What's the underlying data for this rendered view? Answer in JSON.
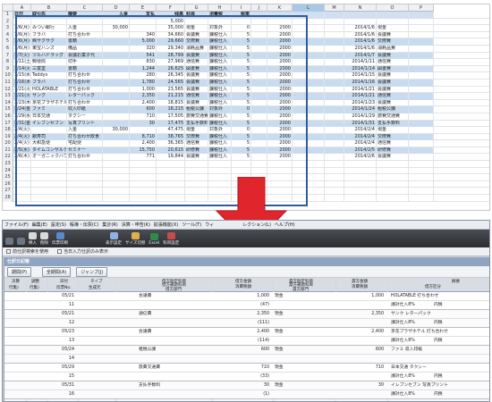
{
  "sheet": {
    "columns": [
      "",
      "A",
      "B",
      "C",
      "D",
      "E",
      "F",
      "G",
      "H",
      "I",
      "J",
      "K",
      "L",
      "M",
      "N",
      "O",
      "P"
    ],
    "selected_column": "L",
    "header_row": {
      "num": "1",
      "cells": [
        "日付",
        "取引先",
        "摘要",
        "入金",
        "支払",
        "残高",
        "科目",
        "消費税",
        "税率"
      ]
    },
    "rows": [
      {
        "num": "2",
        "cells": [
          "",
          "",
          "",
          "",
          "",
          "5,000",
          "",
          "",
          ""
        ]
      },
      {
        "num": "3",
        "cells": [
          "1/6(月)",
          "みつい銀行",
          "入金",
          "30,000",
          "",
          "35,000",
          "現金",
          "対象外",
          "0"
        ],
        "k": "2000",
        "n": "2014/1/6",
        "o": "現金",
        "hl": false
      },
      {
        "num": "4",
        "cells": [
          "1/6(月)",
          "フラバ",
          "打ち合わせ",
          "",
          "340",
          "34,660",
          "会議費",
          "課税仕入",
          "5"
        ],
        "k": "2000",
        "n": "2014/1/6",
        "o": "会議費",
        "hl": false
      },
      {
        "num": "5",
        "cells": [
          "1/6(月)",
          "㈱サクサク",
          "書籍",
          "",
          "5,000",
          "29,660",
          "交際費",
          "課税仕入",
          "5"
        ],
        "k": "2000",
        "n": "2014/1/6",
        "o": "交際費",
        "hl": true
      },
      {
        "num": "6",
        "cells": [
          "1/6(月)",
          "東宝ハンズ",
          "備品",
          "",
          "320",
          "29,340",
          "消耗品費",
          "課税仕入",
          "5"
        ],
        "k": "2000",
        "n": "2014/1/6",
        "o": "消耗品費",
        "hl": false
      },
      {
        "num": "7",
        "cells": [
          "1/7(火)",
          "ツルハドラッグ",
          "会議お菓子代",
          "",
          "541",
          "28,799",
          "会議費",
          "課税仕入",
          "5"
        ],
        "k": "2000",
        "n": "2014/1/7",
        "o": "会議費",
        "hl": true
      },
      {
        "num": "8",
        "cells": [
          "1/11(土)",
          "郵便局",
          "切手",
          "",
          "830",
          "27,969",
          "通信費",
          "課税仕入",
          "5"
        ],
        "k": "2000",
        "n": "2014/1/11",
        "o": "通信費",
        "hl": false
      },
      {
        "num": "9",
        "cells": [
          "1/14(火)",
          "三富堂",
          "書籍",
          "",
          "1,244",
          "26,625",
          "図書費",
          "課税仕入",
          "5"
        ],
        "k": "2000",
        "n": "2014/1/14",
        "o": "図書費",
        "hl": true
      },
      {
        "num": "10",
        "cells": [
          "1/15(水)",
          "Teddys",
          "打ち合わせ",
          "",
          "280",
          "26,345",
          "会議費",
          "課税仕入",
          "5"
        ],
        "k": "2000",
        "n": "2014/1/15",
        "o": "会議費",
        "hl": false
      },
      {
        "num": "11",
        "cells": [
          "1/16(木)",
          "フラバ",
          "打ち合わせ",
          "",
          "1,780",
          "24,565",
          "会議費",
          "課税仕入",
          "5"
        ],
        "k": "2000",
        "n": "2014/1/16",
        "o": "会議費",
        "hl": true
      },
      {
        "num": "12",
        "cells": [
          "1/21(火)",
          "HOLATABLE",
          "打ち合わせ",
          "",
          "1,000",
          "23,565",
          "会議費",
          "課税仕入",
          "5"
        ],
        "k": "2000",
        "n": "2014/1/21",
        "o": "会議費",
        "hl": false
      },
      {
        "num": "13",
        "cells": [
          "1/21(火)",
          "サンク",
          "レターパック",
          "",
          "2,350",
          "21,215",
          "通信費",
          "課税仕入",
          "5"
        ],
        "k": "2000",
        "n": "2014/1/21",
        "o": "通信費",
        "hl": true
      },
      {
        "num": "14",
        "cells": [
          "1/23(木)",
          "京花プラザホテル",
          "打ち合わせ",
          "",
          "2,400",
          "18,815",
          "会議費",
          "課税仕入",
          "5"
        ],
        "k": "2000",
        "n": "2014/1/23",
        "o": "会議費",
        "hl": false
      },
      {
        "num": "15",
        "cells": [
          "1/24(金)",
          "ファミ",
          "収入印紙",
          "",
          "600",
          "18,215",
          "租税公課",
          "対象外",
          "0"
        ],
        "k": "2000",
        "n": "2014/1/24",
        "o": "租税公課",
        "hl": true
      },
      {
        "num": "16",
        "cells": [
          "1/29(水)",
          "日本交通",
          "タクシー",
          "",
          "710",
          "17,505",
          "旅費交通費",
          "課税仕入",
          "5"
        ],
        "k": "2000",
        "n": "2014/1/29",
        "o": "旅費交通費",
        "hl": false
      },
      {
        "num": "17",
        "cells": [
          "1/31(金)",
          "イレブンセブン",
          "写真プリント",
          "",
          "30",
          "17,475",
          "支払手数料",
          "課税仕入",
          "5"
        ],
        "k": "2000",
        "n": "2014/1/31",
        "o": "支払手数料",
        "hl": true
      },
      {
        "num": "18",
        "cells": [
          "2/4(火)",
          "",
          "入金",
          "30,000",
          "",
          "47,475",
          "現金",
          "対象外",
          "0"
        ],
        "k": "2000",
        "n": "2014/2/4",
        "o": "現金",
        "hl": false
      },
      {
        "num": "19",
        "cells": [
          "2/4(火)",
          "銀寿司",
          "打ち合わせ飲食",
          "",
          "8,710",
          "38,765",
          "交際費",
          "課税仕入",
          "5"
        ],
        "k": "2000",
        "n": "2014/2/4",
        "o": "交際費",
        "hl": true
      },
      {
        "num": "20",
        "cells": [
          "2/4(火)",
          "大和急便",
          "宅配便",
          "",
          "2,400",
          "36,365",
          "通信費",
          "課税仕入",
          "5"
        ],
        "k": "2000",
        "n": "2014/2/4",
        "o": "通信費",
        "hl": false
      },
      {
        "num": "21",
        "cells": [
          "2/5(水)",
          "タイムコンサルティング",
          "セミナー",
          "",
          "15,750",
          "20,615",
          "研修費",
          "課税仕入",
          "5"
        ],
        "k": "2000",
        "n": "2014/2/5",
        "o": "研修費",
        "hl": true
      },
      {
        "num": "22",
        "cells": [
          "2/6(木)",
          "オーガニックハウス",
          "打ち合わせ",
          "",
          "771",
          "19,844",
          "会議費",
          "課税仕入",
          "5"
        ],
        "k": "2000",
        "n": "2014/2/6",
        "o": "会議費",
        "hl": false
      },
      {
        "num": "23",
        "cells": [
          "",
          "",
          "",
          "",
          "",
          "",
          "",
          "",
          ""
        ]
      },
      {
        "num": "24",
        "cells": [
          "",
          "",
          "",
          "",
          "",
          "",
          "",
          "",
          ""
        ]
      },
      {
        "num": "25",
        "cells": [
          "",
          "",
          "",
          "",
          "",
          "",
          "",
          "",
          ""
        ]
      },
      {
        "num": "26",
        "cells": [
          "",
          "",
          "",
          "",
          "",
          "",
          "",
          "",
          ""
        ]
      },
      {
        "num": "27",
        "cells": [
          "",
          "",
          "",
          "",
          "",
          "",
          "",
          "",
          ""
        ]
      },
      {
        "num": "28",
        "cells": [
          "",
          "",
          "",
          "",
          "",
          "",
          "",
          "",
          ""
        ]
      }
    ]
  },
  "app": {
    "menu": [
      "ファイル(F)",
      "編集(E)",
      "設定(S)",
      "帳簿・伝票(C)",
      "集計(R)",
      "決算・申告(K)",
      "拡張機能(X)",
      "ツール(T)",
      "ウィ",
      "",
      "レクション(L)",
      "ヘルプ(H)"
    ],
    "toolbar": [
      "",
      "",
      "挿入",
      "削除",
      "伝票印刷",
      "",
      "表示設定",
      "サイズ切替",
      "Excel",
      "科目設定"
    ],
    "options": [
      "前仕訳検索を使用",
      "当日入力仕訳のみ表示"
    ],
    "panel_title": "仕訳日記帳",
    "buttons": [
      "期間(P)",
      "全期間(A)",
      "ジャンプ(J)"
    ],
    "headers": {
      "kessai": "決算",
      "kessai2": "行集)",
      "choshu": "調整",
      "choshu2": "行集)",
      "date": "日付",
      "no": "伝票No.",
      "type": "タイプ",
      "type2": "生成元",
      "debit": "借方勘定科目",
      "debit2": "借方補助科目",
      "debit3": "借方部門",
      "damt": "借方金額",
      "dtax": "消費税額",
      "credit": "貸方勘定科目",
      "credit2": "貸方補助科目",
      "credit3": "貸方部門",
      "camt": "貸方金額",
      "ctax": "消費税額",
      "desc": "摘要",
      "desc2": "借方区分"
    },
    "entries": [
      {
        "date": "05/21",
        "no": "11",
        "debit": "会議費",
        "amt": "1,000",
        "tax": "(47)",
        "credit": "現金",
        "camt": "1,000",
        "desc": "HOLATABLE 打ち合わせ",
        "cls": "課対仕入8%",
        "cls2": "内税"
      },
      {
        "date": "05/21",
        "no": "12",
        "debit": "通信費",
        "amt": "2,350",
        "tax": "(111)",
        "credit": "現金",
        "camt": "2,350",
        "desc": "サンク レターパック",
        "cls": "課対仕入8%",
        "cls2": "内税"
      },
      {
        "date": "05/23",
        "no": "13",
        "debit": "会議費",
        "amt": "2,400",
        "tax": "(114)",
        "credit": "現金",
        "camt": "2,400",
        "desc": "京花プラザホテル 打ち合わせ",
        "cls": "課対仕入8%",
        "cls2": "内税"
      },
      {
        "date": "05/24",
        "no": "14",
        "debit": "租税公課",
        "amt": "600",
        "tax": "",
        "credit": "現金",
        "camt": "600",
        "desc": "ファミ 収入印紙",
        "cls": "",
        "cls2": ""
      },
      {
        "date": "05/29",
        "no": "15",
        "debit": "旅費交通費",
        "amt": "710",
        "tax": "(33)",
        "credit": "現金",
        "camt": "710",
        "desc": "日本交通 タクシー",
        "cls": "課対仕入8%",
        "cls2": "内税"
      },
      {
        "date": "05/31",
        "no": "16",
        "debit": "支払手数料",
        "amt": "30",
        "tax": "(1)",
        "credit": "現金",
        "camt": "30",
        "desc": "イレブンセブン 写真プリント",
        "cls": "課対仕入8%",
        "cls2": "内税"
      }
    ]
  }
}
